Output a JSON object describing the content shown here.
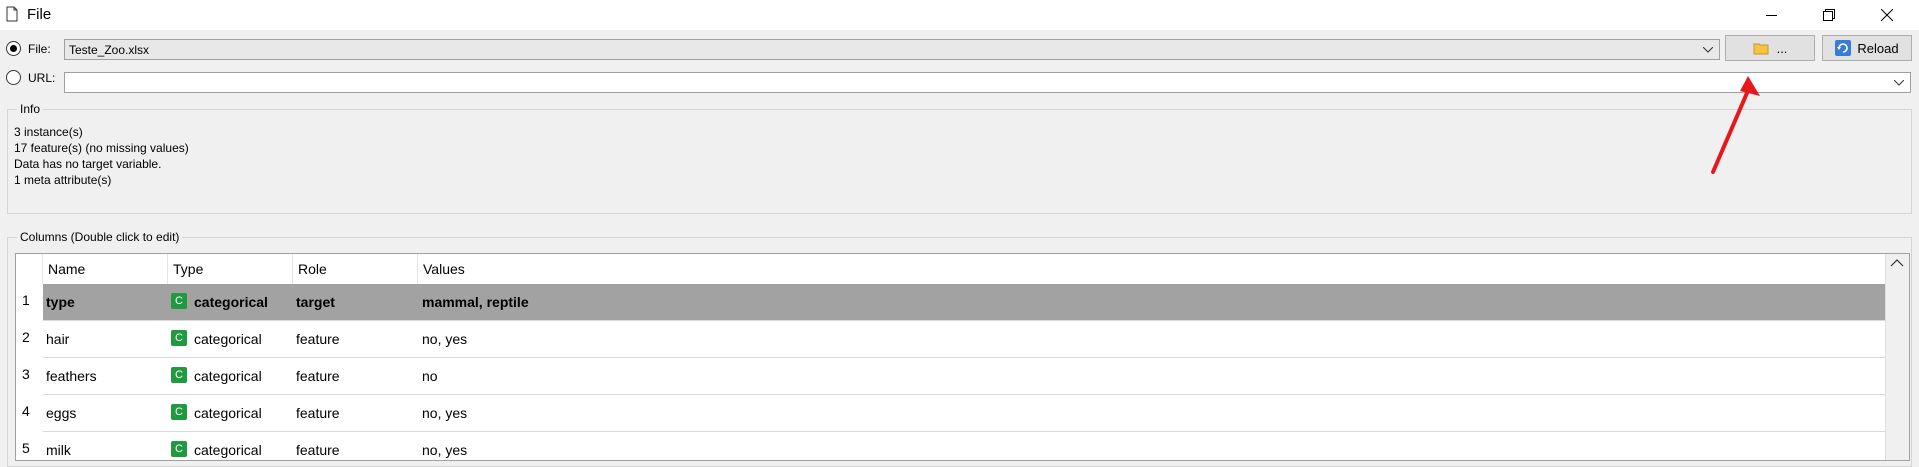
{
  "window": {
    "title": "File",
    "controls": [
      "minimize",
      "restore",
      "close"
    ]
  },
  "source": {
    "file": {
      "label": "File:",
      "selected": true,
      "value": "Teste_Zoo.xlsx"
    },
    "url": {
      "label": "URL:",
      "selected": false,
      "value": ""
    },
    "browse_label": "...",
    "reload_label": "Reload"
  },
  "info": {
    "title": "Info",
    "lines": [
      "3 instance(s)",
      "17 feature(s) (no missing values)",
      "Data has no target variable.",
      "1 meta attribute(s)"
    ]
  },
  "columns": {
    "title": "Columns (Double click to edit)",
    "headers": [
      "Name",
      "Type",
      "Role",
      "Values"
    ],
    "rows": [
      {
        "num": "1",
        "name": "type",
        "type_badge": "C",
        "type": "categorical",
        "role": "target",
        "values": "mammal, reptile"
      },
      {
        "num": "2",
        "name": "hair",
        "type_badge": "C",
        "type": "categorical",
        "role": "feature",
        "values": "no, yes"
      },
      {
        "num": "3",
        "name": "feathers",
        "type_badge": "C",
        "type": "categorical",
        "role": "feature",
        "values": "no"
      },
      {
        "num": "4",
        "name": "eggs",
        "type_badge": "C",
        "type": "categorical",
        "role": "feature",
        "values": "no, yes"
      },
      {
        "num": "5",
        "name": "milk",
        "type_badge": "C",
        "type": "categorical",
        "role": "feature",
        "values": "no, yes"
      }
    ]
  },
  "colors": {
    "annotation_arrow": "#e8171b",
    "selected_row": "#a2a2a2",
    "categorical_badge": "#1f9a3e"
  }
}
